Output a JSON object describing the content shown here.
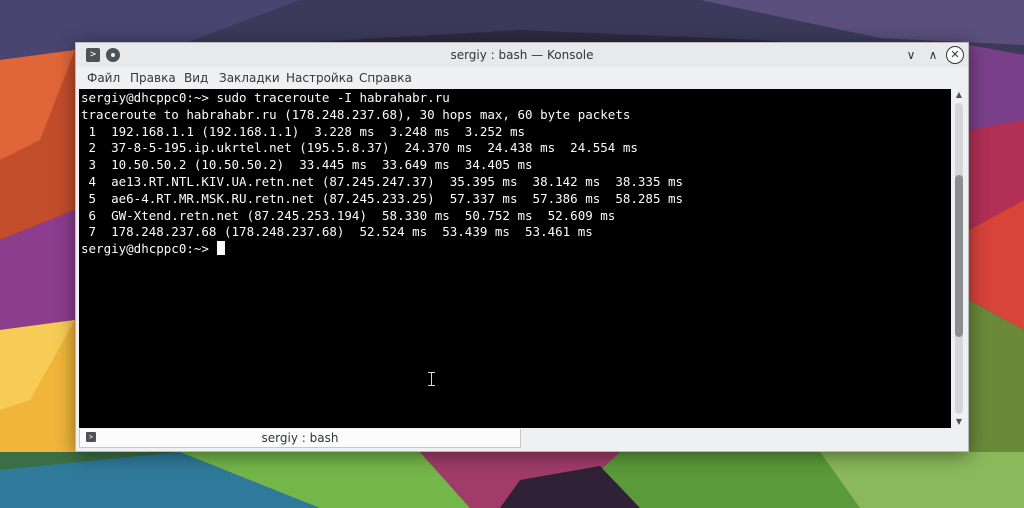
{
  "window": {
    "title": "sergiy : bash — Konsole",
    "app_icon": "terminal-icon",
    "app_icon_glyph": ">",
    "pin_icon": "pin-icon",
    "minimize_icon": "chevron-down-icon",
    "minimize_glyph": "∨",
    "maximize_icon": "chevron-up-icon",
    "maximize_glyph": "∧",
    "close_icon": "close-icon",
    "close_glyph": "✕"
  },
  "menubar": {
    "items": [
      "Файл",
      "Правка",
      "Вид",
      "Закладки",
      "Настройка",
      "Справка"
    ]
  },
  "terminal": {
    "lines": [
      "sergiy@dhcppc0:~> sudo traceroute -I habrahabr.ru",
      "traceroute to habrahabr.ru (178.248.237.68), 30 hops max, 60 byte packets",
      " 1  192.168.1.1 (192.168.1.1)  3.228 ms  3.248 ms  3.252 ms",
      " 2  37-8-5-195.ip.ukrtel.net (195.5.8.37)  24.370 ms  24.438 ms  24.554 ms",
      " 3  10.50.50.2 (10.50.50.2)  33.445 ms  33.649 ms  34.405 ms",
      " 4  ae13.RT.NTL.KIV.UA.retn.net (87.245.247.37)  35.395 ms  38.142 ms  38.335 ms",
      " 5  ae6-4.RT.MR.MSK.RU.retn.net (87.245.233.25)  57.337 ms  57.386 ms  58.285 ms",
      " 6  GW-Xtend.retn.net (87.245.253.194)  58.330 ms  50.752 ms  52.609 ms",
      " 7  178.248.237.68 (178.248.237.68)  52.524 ms  53.439 ms  53.461 ms"
    ],
    "prompt": "sergiy@dhcppc0:~> ",
    "background": "#000000",
    "foreground": "#fcfcfc"
  },
  "scrollbar": {
    "up_glyph": "▲",
    "down_glyph": "▼",
    "position": 0.48,
    "visible_fraction": 0.52
  },
  "tabs": [
    {
      "label": "sergiy : bash",
      "icon": "terminal-icon",
      "icon_glyph": ">"
    }
  ],
  "colors": {
    "accent": "#3daee9",
    "window_bg": "#eff0f1",
    "text": "#31363b"
  }
}
